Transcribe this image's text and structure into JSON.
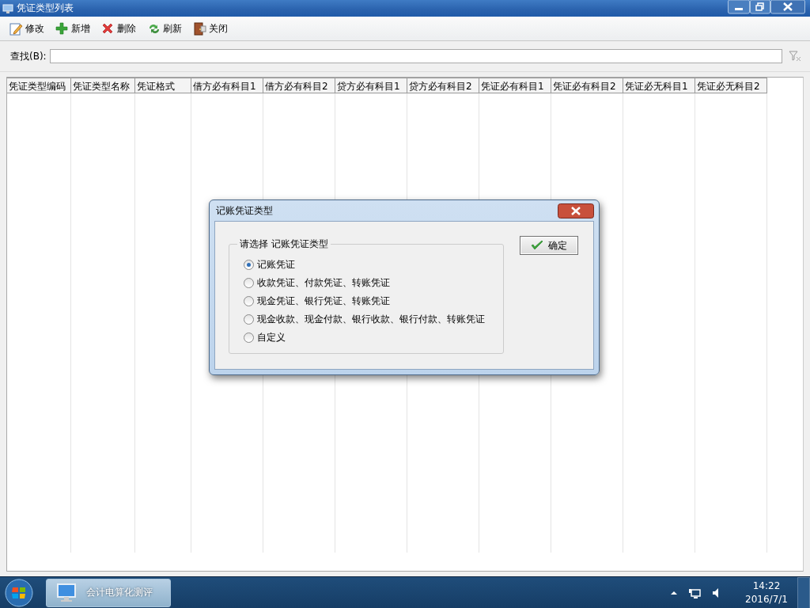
{
  "window": {
    "title": "凭证类型列表"
  },
  "toolbar": [
    {
      "label": "修改",
      "kind": "edit"
    },
    {
      "label": "新增",
      "kind": "add"
    },
    {
      "label": "删除",
      "kind": "delete"
    },
    {
      "label": "刷新",
      "kind": "refresh"
    },
    {
      "label": "关闭",
      "kind": "exit"
    }
  ],
  "search": {
    "label": "查找(B):"
  },
  "table": {
    "columns": [
      "凭证类型编码",
      "凭证类型名称",
      "凭证格式",
      "借方必有科目1",
      "借方必有科目2",
      "贷方必有科目1",
      "贷方必有科目2",
      "凭证必有科目1",
      "凭证必有科目2",
      "凭证必无科目1",
      "凭证必无科目2"
    ]
  },
  "dialog": {
    "title": "记账凭证类型",
    "group_label": "请选择 记账凭证类型",
    "options": [
      {
        "label": "记账凭证",
        "selected": true
      },
      {
        "label": "收款凭证、付款凭证、转账凭证",
        "selected": false
      },
      {
        "label": "现金凭证、银行凭证、转账凭证",
        "selected": false
      },
      {
        "label": "现金收款、现金付款、银行收款、银行付款、转账凭证",
        "selected": false
      },
      {
        "label": "自定义",
        "selected": false
      }
    ],
    "button": "确定"
  },
  "taskbar": {
    "apps": [
      {
        "label": "会计电算化测评"
      }
    ],
    "time": "14:22",
    "date": "2016/7/1"
  }
}
